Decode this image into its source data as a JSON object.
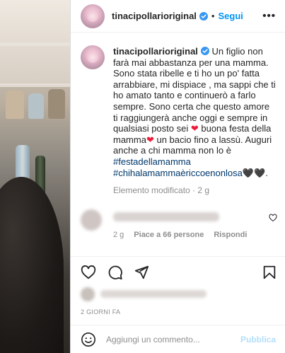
{
  "post": {
    "username": "tinacipollarioriginal",
    "follow_label": "Segui",
    "separator": "•",
    "more_label": "•••"
  },
  "caption": {
    "username": "tinacipollarioriginal",
    "text_1": " Un figlio non farà mai abbastanza per una mamma. Sono stata ribelle e ti ho un po' fatta arrabbiare, mi dispiace , ma sappi che ti ho amato tanto e continuerò a farlo sempre. Sono certa che questo amore ti raggiungerà anche oggi e sempre in qualsiasi posto sei ",
    "heart_1": "❤",
    "text_2": " buona festa della mamma",
    "heart_2": "❤",
    "text_3": "  un bacio fino a lassù. Auguri anche a chi mamma non lo è ",
    "hashtag_1": "#festadellamamma",
    "hashtag_2": "#chihalamammaèriccoenonlosa",
    "hearts_end": "🖤🖤.",
    "meta": "Elemento modificato · 2 g"
  },
  "comment": {
    "time": "2 g",
    "likes": "Piace a 66 persone",
    "reply": "Rispondi"
  },
  "date": "2 GIORNI FA",
  "add_comment": {
    "placeholder": "Aggiungi un commento...",
    "publish": "Pubblica"
  },
  "colors": {
    "accent": "#0095f6",
    "hashtag": "#00376b",
    "heart": "#ed1c3a"
  }
}
